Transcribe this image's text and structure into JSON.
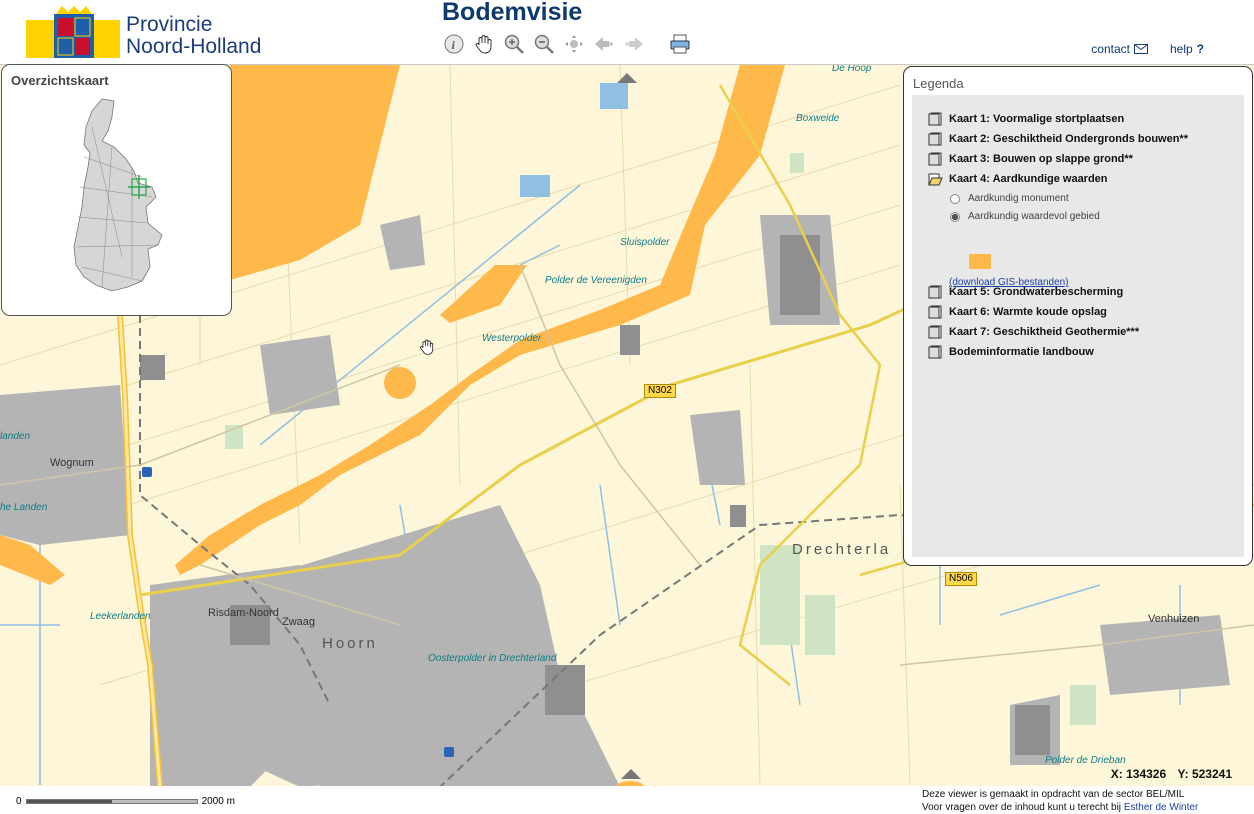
{
  "header": {
    "org_line1": "Provincie",
    "org_line2": "Noord-Holland",
    "logo_letters": "NH",
    "app_title": "Bodemvisie",
    "toolbar": [
      "info-icon",
      "pan-hand-icon",
      "zoom-in-icon",
      "zoom-out-icon",
      "full-extent-icon",
      "previous-extent-icon",
      "next-extent-icon",
      "print-icon"
    ],
    "contact_label": "contact",
    "help_label": "help",
    "help_mark": "?"
  },
  "overview": {
    "title": "Overzichtskaart"
  },
  "legend": {
    "title": "Legenda",
    "items": [
      {
        "label": "Kaart 1: Voormalige stortplaatsen"
      },
      {
        "label": "Kaart 2: Geschiktheid Ondergronds bouwen**"
      },
      {
        "label": "Kaart 3: Bouwen op slappe grond**"
      },
      {
        "label": "Kaart 4: Aardkundige waarden"
      },
      {
        "label": "Kaart 5: Grondwaterbescherming"
      },
      {
        "label": "Kaart 6: Warmte koude opslag"
      },
      {
        "label": "Kaart 7: Geschiktheid Geothermie***"
      },
      {
        "label": "Bodeminformatie landbouw"
      }
    ],
    "sub_items": [
      {
        "label": "Aardkundig monument",
        "selected": false
      },
      {
        "label": "Aardkundig waardevol gebied",
        "selected": true
      }
    ],
    "swatch_color": "#ffb84a",
    "download_label": "(download GIS-bestanden)"
  },
  "map": {
    "labels": {
      "de_hoop": "De Hoop",
      "boxweide": "Boxweide",
      "sluispolder": "Sluispolder",
      "polder_vereenigden": "Polder de Vereenigden",
      "westerpolder": "Westerpolder",
      "wognum": "Wognum",
      "landen_left": "landen",
      "de_landen": "he Landen",
      "drechterland": "Drechterla",
      "risdam_noord": "Risdam-Noord",
      "zwaag": "Zwaag",
      "hoorn": "Hoorn",
      "oosterpolder": "Oosterpolder in Drechterland",
      "leekerlanden": "Leekerlanden",
      "venhuizen": "Venhuizen",
      "polder_drieban": "Polder de Drieban"
    },
    "roads": {
      "n302": "N302",
      "n506": "N506"
    },
    "coords": {
      "x": "X: 134326",
      "y": "Y: 523241"
    },
    "colors": {
      "land": "#fdf6d8",
      "aardkundig": "#ffb84a",
      "built": "#a9a9a9",
      "water": "#8fc0e3"
    }
  },
  "footer": {
    "scale_start": "0",
    "scale_end": "2000 m",
    "credit_line1": "Deze viewer is gemaakt in opdracht van de sector BEL/MIL",
    "credit_line2": "Voor vragen over de inhoud kunt u terecht bij",
    "credit_link": "Esther de Winter"
  }
}
